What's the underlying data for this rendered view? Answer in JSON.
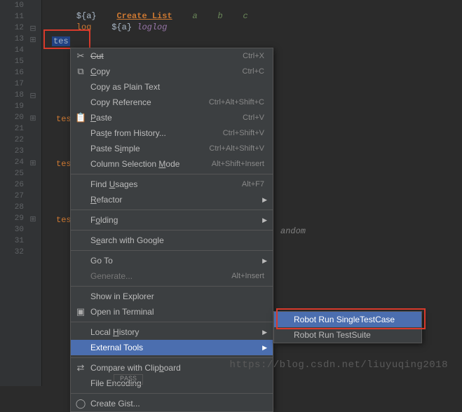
{
  "gutter": {
    "lines": [
      "10",
      "11",
      "12",
      "13",
      "14",
      "15",
      "16",
      "17",
      "18",
      "19",
      "20",
      "21",
      "22",
      "23",
      "24",
      "25",
      "26",
      "27",
      "28",
      "29",
      "30",
      "31",
      "32"
    ]
  },
  "code": {
    "l10_var": "${a}",
    "l10_kw": "Create List",
    "l10_a": "a",
    "l10_b": "b",
    "l10_c": "c",
    "l11_log": "log",
    "l11_var": "${a}",
    "l11_tail": "loglog",
    "sel": "tes",
    "tes20": "tes",
    "tes24": "tes",
    "tes29": "tes",
    "random": "andom"
  },
  "menu": {
    "cut": "Cut",
    "cut_sc": "Ctrl+X",
    "copy": "Copy",
    "copy_sc": "Ctrl+C",
    "copy_plain": "Copy as Plain Text",
    "copy_ref": "Copy Reference",
    "copy_ref_sc": "Ctrl+Alt+Shift+C",
    "paste": "Paste",
    "paste_sc": "Ctrl+V",
    "paste_hist": "Paste from History...",
    "paste_hist_sc": "Ctrl+Shift+V",
    "paste_simple": "Paste Simple",
    "paste_simple_sc": "Ctrl+Alt+Shift+V",
    "col_sel": "Column Selection Mode",
    "col_sel_sc": "Alt+Shift+Insert",
    "find_usages": "Find Usages",
    "find_usages_sc": "Alt+F7",
    "refactor": "Refactor",
    "folding": "Folding",
    "search_google": "Search with Google",
    "goto": "Go To",
    "generate": "Generate...",
    "generate_sc": "Alt+Insert",
    "show_explorer": "Show in Explorer",
    "open_terminal": "Open in Terminal",
    "local_history": "Local History",
    "external_tools": "External Tools",
    "compare_clip": "Compare with Clipboard",
    "file_encoding": "File Encoding",
    "create_gist": "Create Gist..."
  },
  "submenu": {
    "run_single": "Robot Run SingleTestCase",
    "run_suite": "Robot Run TestSuite"
  },
  "watermark": "https://blog.csdn.net/liuyuqing2018",
  "bottom_tab": "PASS"
}
